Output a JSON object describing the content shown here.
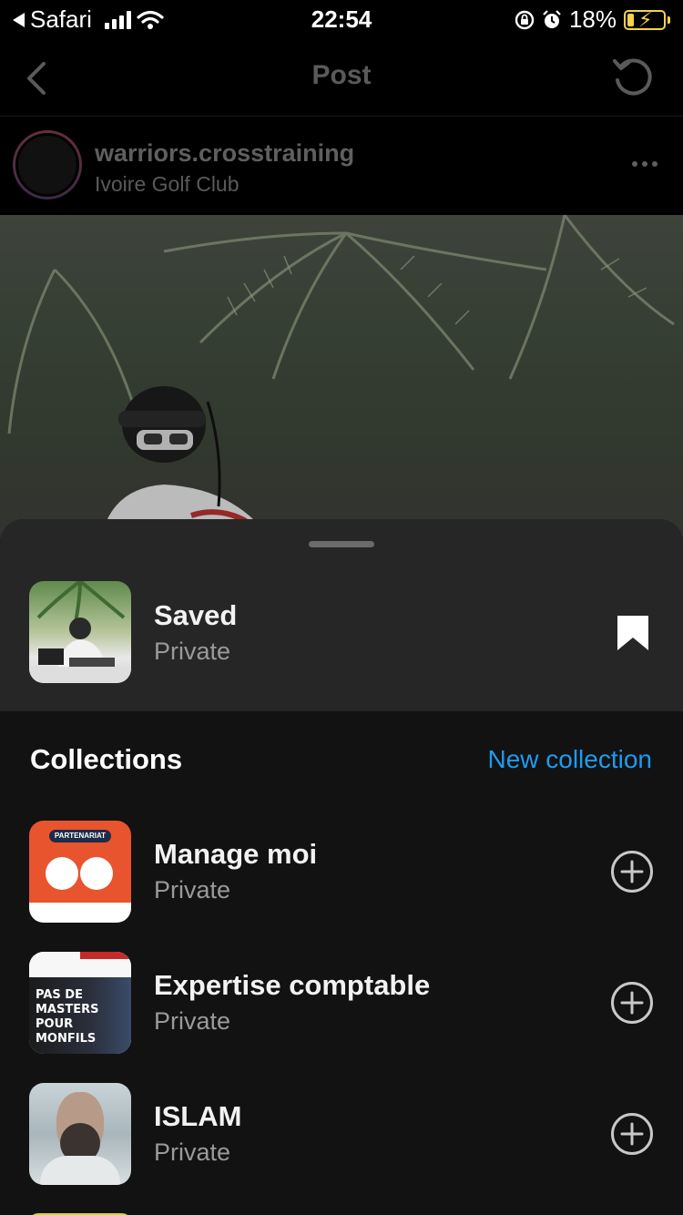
{
  "status_bar": {
    "back_app": "Safari",
    "time": "22:54",
    "battery": "18%",
    "battery_level": 0.18
  },
  "nav": {
    "title": "Post"
  },
  "post": {
    "username": "warriors.crosstraining",
    "location": "Ivoire Golf Club"
  },
  "sheet": {
    "saved": {
      "title": "Saved",
      "subtitle": "Private"
    },
    "collections_heading": "Collections",
    "new_collection_label": "New collection",
    "collections": [
      {
        "title": "Manage moi",
        "subtitle": "Private"
      },
      {
        "title": "Expertise comptable",
        "subtitle": "Private"
      },
      {
        "title": "ISLAM",
        "subtitle": "Private"
      }
    ]
  },
  "colors": {
    "accent": "#1d9bf0",
    "sheet_bg": "#121212",
    "saved_row_bg": "#262626",
    "battery": "#f5d447"
  },
  "icons": [
    "back-arrow-icon",
    "signal-icon",
    "wifi-icon",
    "rotation-lock-icon",
    "alarm-icon",
    "battery-icon",
    "chevron-left-icon",
    "refresh-icon",
    "more-icon",
    "bookmark-icon",
    "add-circle-icon"
  ]
}
